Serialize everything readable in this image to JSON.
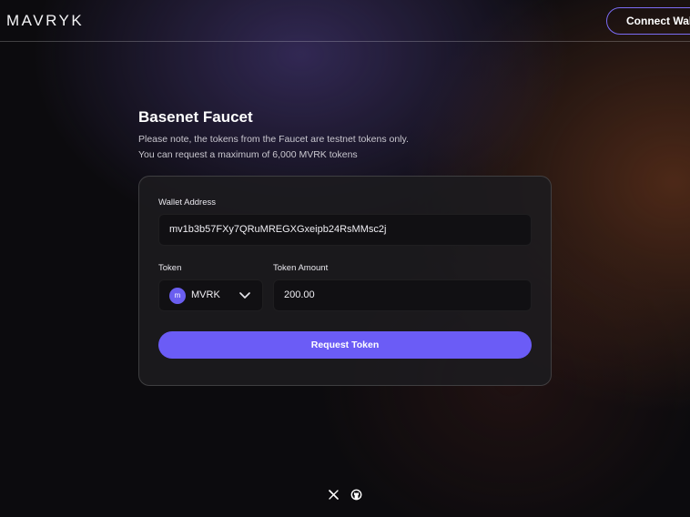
{
  "header": {
    "logo": "MAVRYK",
    "connect_wallet_label": "Connect Walle"
  },
  "main": {
    "title": "Basenet Faucet",
    "note_line1": "Please note, the tokens from the Faucet are testnet tokens only.",
    "note_line2": "You can request a maximum of 6,000 MVRK tokens"
  },
  "form": {
    "wallet_label": "Wallet Address",
    "wallet_value": "mv1b3b57FXy7QRuMREGXGxeipb24RsMMsc2j",
    "token_label": "Token",
    "token_icon_letter": "m",
    "token_value": "MVRK",
    "amount_label": "Token Amount",
    "amount_value": "200.00",
    "request_label": "Request Token"
  },
  "footer": {
    "icons": [
      "x-icon",
      "github-icon"
    ]
  },
  "colors": {
    "accent": "#6b5cf6",
    "border_accent": "#7b6cf5",
    "card": "#1c1b1f",
    "field": "#111013"
  }
}
